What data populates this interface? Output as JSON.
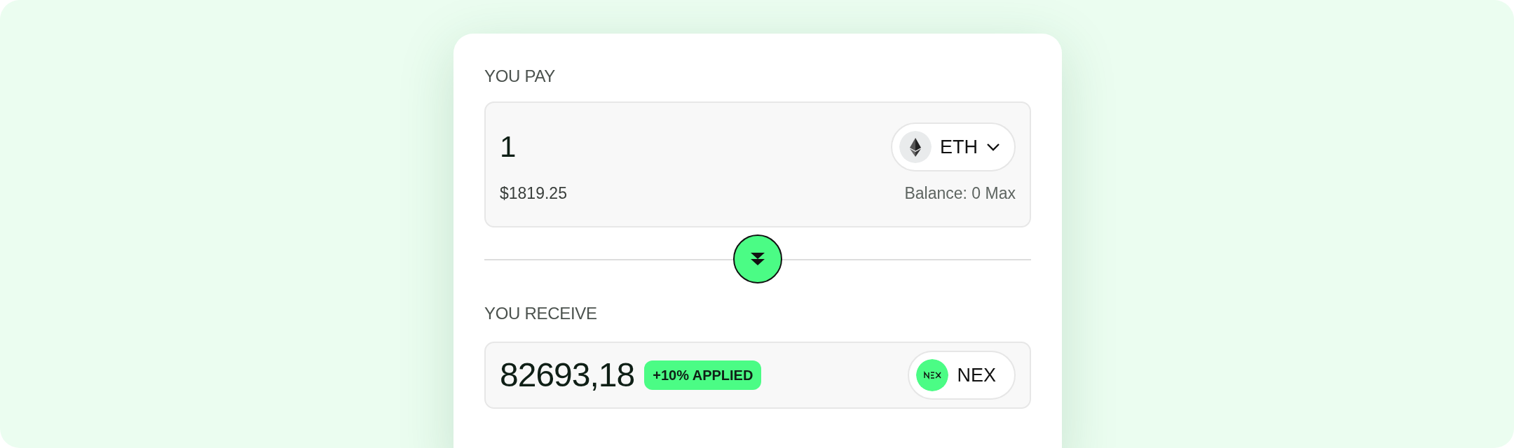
{
  "pay": {
    "label": "YOU PAY",
    "amount": "1",
    "fiat": "$1819.25",
    "balance": "Balance: 0 Max",
    "token": {
      "symbol": "ETH",
      "kind": "eth",
      "dropdown": true
    }
  },
  "receive": {
    "label": "YOU RECEIVE",
    "amount": "82693,18",
    "badge": "+10% APPLIED",
    "token": {
      "symbol": "NEX",
      "kind": "nex",
      "dropdown": false
    }
  }
}
